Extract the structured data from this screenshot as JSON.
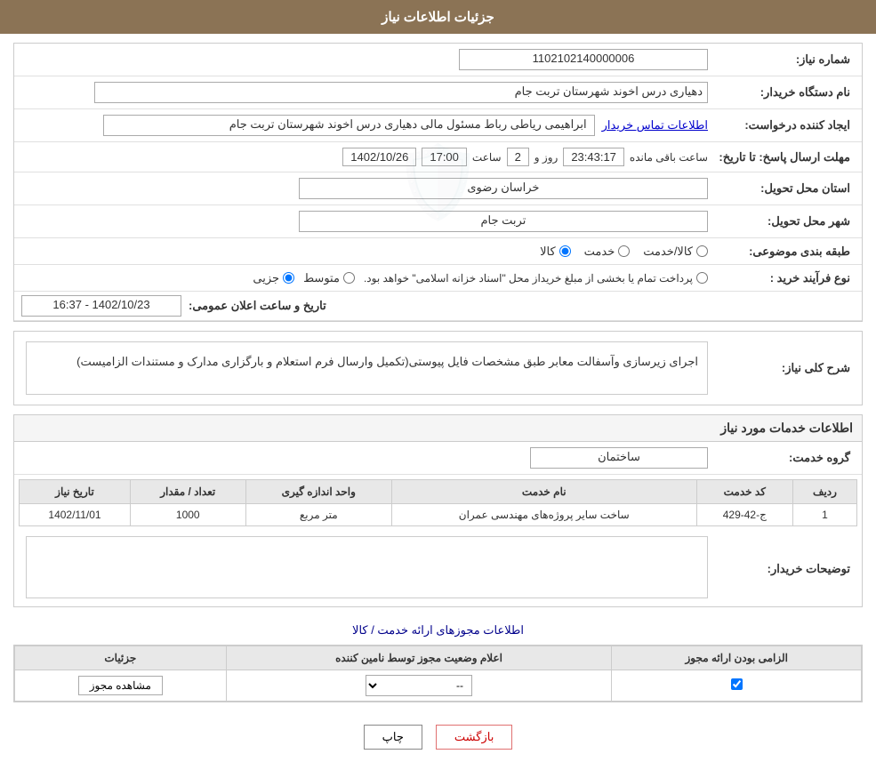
{
  "header": {
    "title": "جزئیات اطلاعات نیاز"
  },
  "fields": {
    "need_number_label": "شماره نیاز:",
    "need_number_value": "1102102140000006",
    "buyer_org_label": "نام دستگاه خریدار:",
    "buyer_org_value": "دهیاری درس اخوند  شهرستان تربت جام",
    "requester_label": "ایجاد کننده درخواست:",
    "requester_value": "ابراهیمی ریاطی رباط مسئول مالی دهیاری درس اخوند  شهرستان تربت جام",
    "requester_link": "اطلاعات تماس خریدار",
    "deadline_label": "مهلت ارسال پاسخ: تا تاریخ:",
    "deadline_date": "1402/10/26",
    "deadline_time_label": "ساعت",
    "deadline_time": "17:00",
    "deadline_days_label": "روز و",
    "deadline_days": "2",
    "deadline_countdown": "23:43:17",
    "deadline_remaining_label": "ساعت باقی مانده",
    "province_label": "استان محل تحویل:",
    "province_value": "خراسان رضوی",
    "city_label": "شهر محل تحویل:",
    "city_value": "تربت جام",
    "category_label": "طبقه بندی موضوعی:",
    "category_radio1": "کالا",
    "category_radio2": "خدمت",
    "category_radio3": "کالا/خدمت",
    "process_label": "نوع فرآیند خرید :",
    "process_radio1": "جزیی",
    "process_radio2": "متوسط",
    "process_radio3": "پرداخت تمام یا بخشی از مبلغ خریداز محل \"اسناد خزانه اسلامی\" خواهد بود.",
    "announcement_label": "تاریخ و ساعت اعلان عمومی:",
    "announcement_value": "1402/10/23 - 16:37"
  },
  "description": {
    "section_label": "شرح کلی نیاز:",
    "text": "اجرای زیرسازی وآسفالت معابر طبق مشخصات فایل پیوستی(تکمیل وارسال فرم استعلام و بارگزاری  مدارک  و مستندات الزامیست)"
  },
  "services_section": {
    "title": "اطلاعات خدمات مورد نیاز",
    "group_label": "گروه خدمت:",
    "group_value": "ساختمان",
    "columns": {
      "row_num": "ردیف",
      "service_code": "کد خدمت",
      "service_name": "نام خدمت",
      "unit": "واحد اندازه گیری",
      "quantity": "تعداد / مقدار",
      "date": "تاریخ نیاز"
    },
    "rows": [
      {
        "row_num": "1",
        "service_code": "ج-42-429",
        "service_name": "ساخت سایر پروژه‌های مهندسی عمران",
        "unit": "متر مربع",
        "quantity": "1000",
        "date": "1402/11/01"
      }
    ]
  },
  "buyer_notes": {
    "label": "توضیحات خریدار:",
    "value": ""
  },
  "permissions_section": {
    "title": "اطلاعات مجوزهای ارائه خدمت / کالا",
    "columns": {
      "required": "الزامی بودن ارائه مجوز",
      "status": "اعلام وضعیت مجوز توسط نامین کننده",
      "details": "جزئیات"
    },
    "rows": [
      {
        "required_checked": true,
        "status_value": "--",
        "details_label": "مشاهده مجوز"
      }
    ]
  },
  "buttons": {
    "back": "بازگشت",
    "print": "چاپ"
  }
}
